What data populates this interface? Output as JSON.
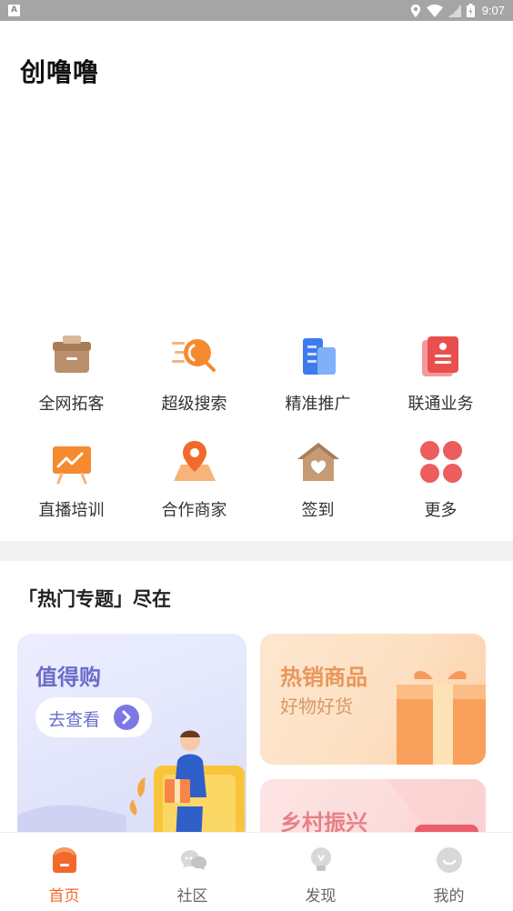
{
  "status_bar": {
    "app_badge": "A",
    "time": "9:07",
    "icons": [
      "location-icon",
      "wifi-icon",
      "signal-icon",
      "battery-icon"
    ]
  },
  "app": {
    "title": "创噜噜"
  },
  "grid": [
    {
      "label": "全网拓客",
      "icon": "box-icon"
    },
    {
      "label": "超级搜索",
      "icon": "search-icon"
    },
    {
      "label": "精准推广",
      "icon": "building-icon"
    },
    {
      "label": "联通业务",
      "icon": "document-icon"
    },
    {
      "label": "直播培训",
      "icon": "live-board-icon"
    },
    {
      "label": "合作商家",
      "icon": "map-pin-icon"
    },
    {
      "label": "签到",
      "icon": "house-heart-icon"
    },
    {
      "label": "更多",
      "icon": "more-icon"
    }
  ],
  "section": {
    "title": "「热门专题」尽在"
  },
  "cards": {
    "worth_buy": {
      "title": "值得购",
      "button": "去查看"
    },
    "hot_goods": {
      "title": "热销商品",
      "subtitle": "好物好货"
    },
    "rural": {
      "title": "乡村振兴"
    }
  },
  "tabbar": [
    {
      "label": "首页",
      "icon": "home-icon",
      "active": true
    },
    {
      "label": "社区",
      "icon": "chat-icon",
      "active": false
    },
    {
      "label": "发现",
      "icon": "bulb-icon",
      "active": false
    },
    {
      "label": "我的",
      "icon": "profile-icon",
      "active": false
    }
  ],
  "colors": {
    "accent": "#f26a2a",
    "purple": "#6b6cc9",
    "orange_text": "#e9975a",
    "pink_text": "#e87f86"
  }
}
